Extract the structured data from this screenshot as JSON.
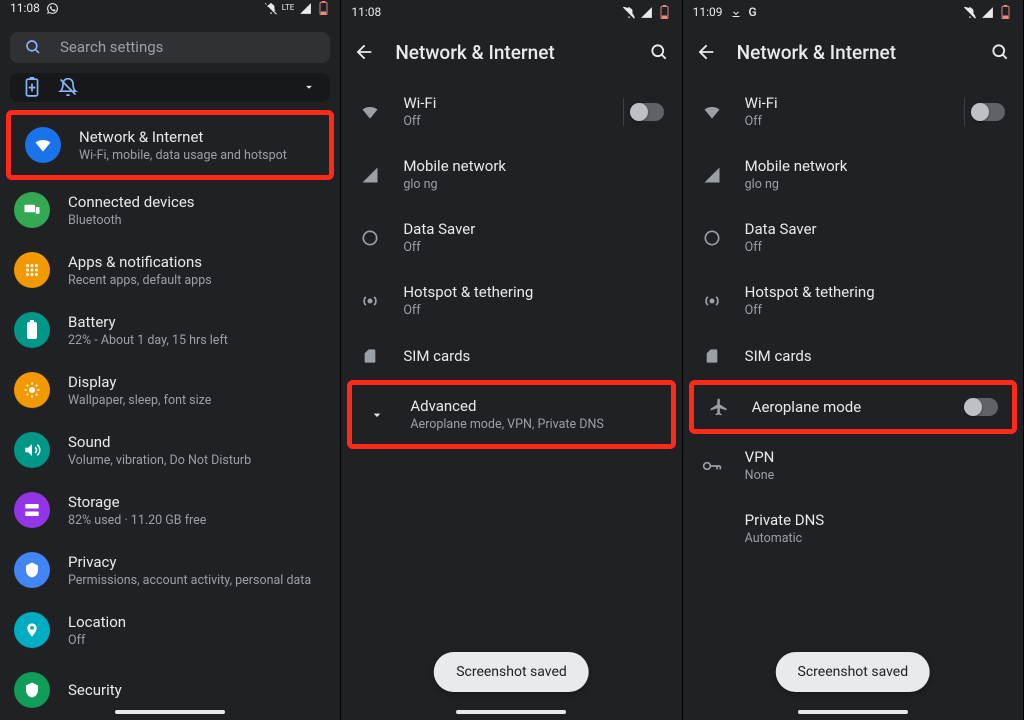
{
  "pane1": {
    "status": {
      "time": "11:08"
    },
    "search": {
      "placeholder": "Search settings"
    },
    "items": [
      {
        "title": "Network & Internet",
        "sub": "Wi-Fi, mobile, data usage and hotspot"
      },
      {
        "title": "Connected devices",
        "sub": "Bluetooth"
      },
      {
        "title": "Apps & notifications",
        "sub": "Recent apps, default apps"
      },
      {
        "title": "Battery",
        "sub": "22% - About 1 day, 15 hrs left"
      },
      {
        "title": "Display",
        "sub": "Wallpaper, sleep, font size"
      },
      {
        "title": "Sound",
        "sub": "Volume, vibration, Do Not Disturb"
      },
      {
        "title": "Storage",
        "sub": "82% used · 11.20 GB free"
      },
      {
        "title": "Privacy",
        "sub": "Permissions, account activity, personal data"
      },
      {
        "title": "Location",
        "sub": "Off"
      },
      {
        "title": "Security",
        "sub": ""
      }
    ]
  },
  "pane2": {
    "status": {
      "time": "11:08"
    },
    "header": "Network & Internet",
    "items": [
      {
        "title": "Wi-Fi",
        "sub": "Off"
      },
      {
        "title": "Mobile network",
        "sub": "glo ng"
      },
      {
        "title": "Data Saver",
        "sub": "Off"
      },
      {
        "title": "Hotspot & tethering",
        "sub": "Off"
      },
      {
        "title": "SIM cards",
        "sub": ""
      },
      {
        "title": "Advanced",
        "sub": "Aeroplane mode, VPN, Private DNS"
      }
    ],
    "toast": "Screenshot saved"
  },
  "pane3": {
    "status": {
      "time": "11:09"
    },
    "header": "Network & Internet",
    "items": [
      {
        "title": "Wi-Fi",
        "sub": "Off"
      },
      {
        "title": "Mobile network",
        "sub": "glo ng"
      },
      {
        "title": "Data Saver",
        "sub": "Off"
      },
      {
        "title": "Hotspot & tethering",
        "sub": "Off"
      },
      {
        "title": "SIM cards",
        "sub": ""
      },
      {
        "title": "Aeroplane mode",
        "sub": ""
      },
      {
        "title": "VPN",
        "sub": "None"
      },
      {
        "title": "Private DNS",
        "sub": "Automatic"
      }
    ],
    "toast": "Screenshot saved"
  },
  "status_extra": {
    "lte": "LTE",
    "g": "G"
  }
}
